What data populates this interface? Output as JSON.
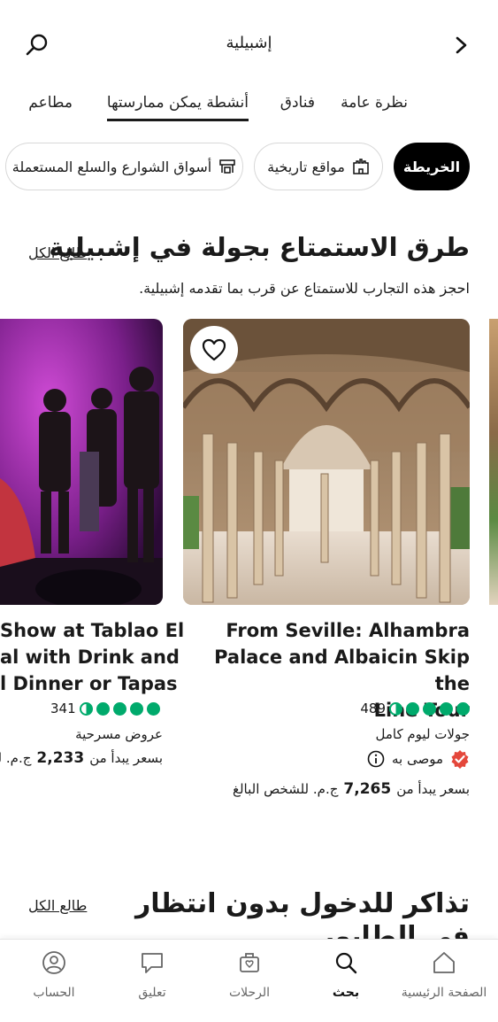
{
  "header": {
    "title": "إشبيلية"
  },
  "tabs": [
    {
      "label": "نظرة عامة",
      "active": false
    },
    {
      "label": "فنادق",
      "active": false
    },
    {
      "label": "أنشطة يمكن ممارستها",
      "active": true
    },
    {
      "label": "مطاعم",
      "active": false
    }
  ],
  "chips": [
    {
      "label": "الخريطة",
      "icon": null
    },
    {
      "label": "مواقع تاريخية",
      "icon": "castle-icon"
    },
    {
      "label": "أسواق الشوارع والسلع المستعملة",
      "icon": "market-stall-icon"
    }
  ],
  "section1": {
    "title": "طرق الاستمتاع بجولة في إشبيلية",
    "subtitle": "احجز هذه التجارب للاستمتاع عن قرب بما تقدمه إشبيلية.",
    "see_all": "طالع الكل"
  },
  "cards": [
    {
      "title_lines": [
        "From Seville: Alhambra",
        "Palace and Albaicin Skip the",
        "Line Tour"
      ],
      "rating": 4.5,
      "reviews": "489",
      "category": "جولات ليوم كامل",
      "badge": "موصى به",
      "price_prefix": "بسعر يبدأ من",
      "price": "7,265",
      "price_suffix": "ج.م. للشخص البالغ"
    },
    {
      "title_lines": [
        "Show at Tablao El",
        "al with Drink and",
        "l Dinner or Tapas"
      ],
      "rating": 4.5,
      "reviews": "341",
      "category": "عروض مسرحية",
      "price_prefix": "بسعر يبدأ من",
      "price": "2,233",
      "price_suffix": "ج.م. لل"
    }
  ],
  "section2": {
    "title_line1": "تذاكر للدخول بدون انتظار",
    "title_line2": "في الطابور",
    "see_all": "طالع الكل"
  },
  "bottom_nav": [
    {
      "label": "الصفحة الرئيسية",
      "icon": "home-icon",
      "active": false
    },
    {
      "label": "بحث",
      "icon": "search-icon",
      "active": true
    },
    {
      "label": "الرحلات",
      "icon": "trips-icon",
      "active": false
    },
    {
      "label": "تعليق",
      "icon": "review-icon",
      "active": false
    },
    {
      "label": "الحساب",
      "icon": "account-icon",
      "active": false
    }
  ],
  "colors": {
    "accent_green": "#00aa6c",
    "badge_red": "#e4473b"
  }
}
